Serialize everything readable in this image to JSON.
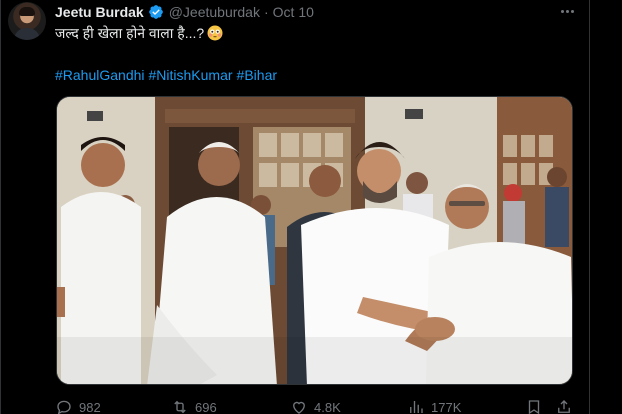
{
  "tweet": {
    "author": {
      "display_name": "Jeetu Burdak",
      "handle": "@Jeetuburdak",
      "verified": true
    },
    "separator": "·",
    "date": "Oct 10",
    "text": "जल्द ही खेला होने वाला है...?",
    "emoji": "flushed-face",
    "hashtags": [
      "#RahulGandhi",
      "#NitishKumar",
      "#Bihar"
    ],
    "media_type": "photo"
  },
  "actions": {
    "replies": "982",
    "retweets": "696",
    "likes": "4.8K",
    "views": "177K"
  },
  "colors": {
    "background": "#000000",
    "text": "#e7e9ea",
    "muted": "#71767b",
    "link": "#1d9bf0",
    "verified": "#1d9bf0",
    "border": "#2f3336"
  }
}
